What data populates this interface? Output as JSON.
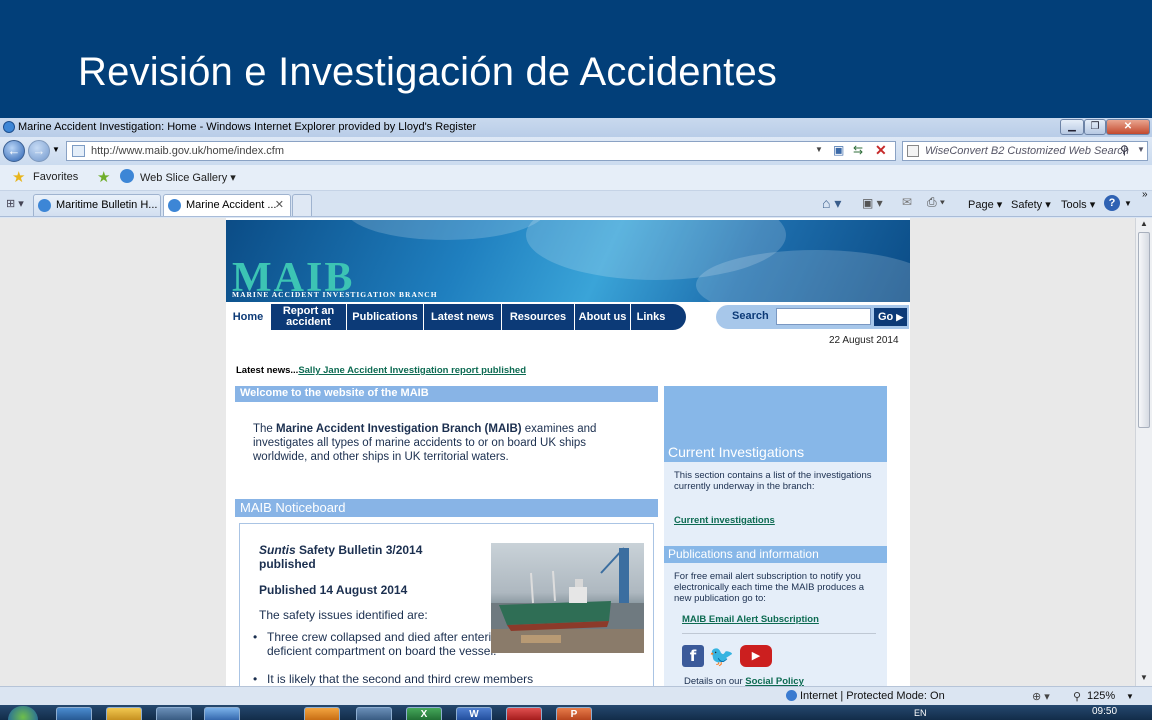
{
  "slide": {
    "title": "Revisión e Investigación de Accidentes"
  },
  "browser": {
    "window_title": "Marine Accident Investigation: Home - Windows Internet Explorer provided by Lloyd's Register",
    "address": "http://www.maib.gov.uk/home/index.cfm",
    "search_placeholder": "WiseConvert B2 Customized Web Search",
    "favorites_label": "Favorites",
    "web_slice_label": "Web Slice Gallery",
    "tabs": [
      {
        "label": "Maritime Bulletin H..."
      },
      {
        "label": "Marine Accident ..."
      }
    ],
    "commands": {
      "page": "Page",
      "safety": "Safety",
      "tools": "Tools"
    },
    "status_zone": "Internet | Protected Mode: On",
    "zoom": "125%"
  },
  "site": {
    "logo": "MAIB",
    "logo_subtitle": "MARINE ACCIDENT INVESTIGATION BRANCH",
    "menu": [
      {
        "label": "Home"
      },
      {
        "label": "Report an accident"
      },
      {
        "label": "Publications"
      },
      {
        "label": "Latest news"
      },
      {
        "label": "Resources"
      },
      {
        "label": "About us"
      },
      {
        "label": "Links"
      }
    ],
    "search_label": "Search",
    "search_go": "Go",
    "date": "22 August 2014",
    "latest_prefix": "Latest news...",
    "latest_link": "Sally Jane Accident Investigation report published",
    "welcome_heading": "Welcome to the website of the MAIB",
    "welcome_pre": "The ",
    "welcome_bold": "Marine Accident Investigation Branch (MAIB)",
    "welcome_post": " examines and investigates all types of marine accidents to or on board UK ships worldwide, and other ships in UK territorial waters.",
    "noticeboard_heading": "MAIB Noticeboard",
    "notice": {
      "title_italic": "Suntis",
      "title_rest": " Safety Bulletin 3/2014 published",
      "published": "Published 14 August 2014",
      "issues_intro": "The safety issues identified are:",
      "bullets": [
        "Three crew collapsed and died after entering an oxygen deficient compartment on board the vessel.",
        "It is likely that the second and third crew members"
      ]
    },
    "sidebar": {
      "current_heading": "Current Investigations",
      "current_text": "This section contains a list of the investigations currently underway in the branch:",
      "current_link": "Current investigations",
      "pub_heading": "Publications and information",
      "pub_text": "For free email alert subscription to notify you electronically each time the MAIB produces a new publication go to:",
      "pub_link": "MAIB Email Alert Subscription",
      "policy_prefix": "Details on our ",
      "policy_link": "Social Policy"
    }
  },
  "taskbar": {
    "lang": "EN",
    "time": "09:50"
  }
}
